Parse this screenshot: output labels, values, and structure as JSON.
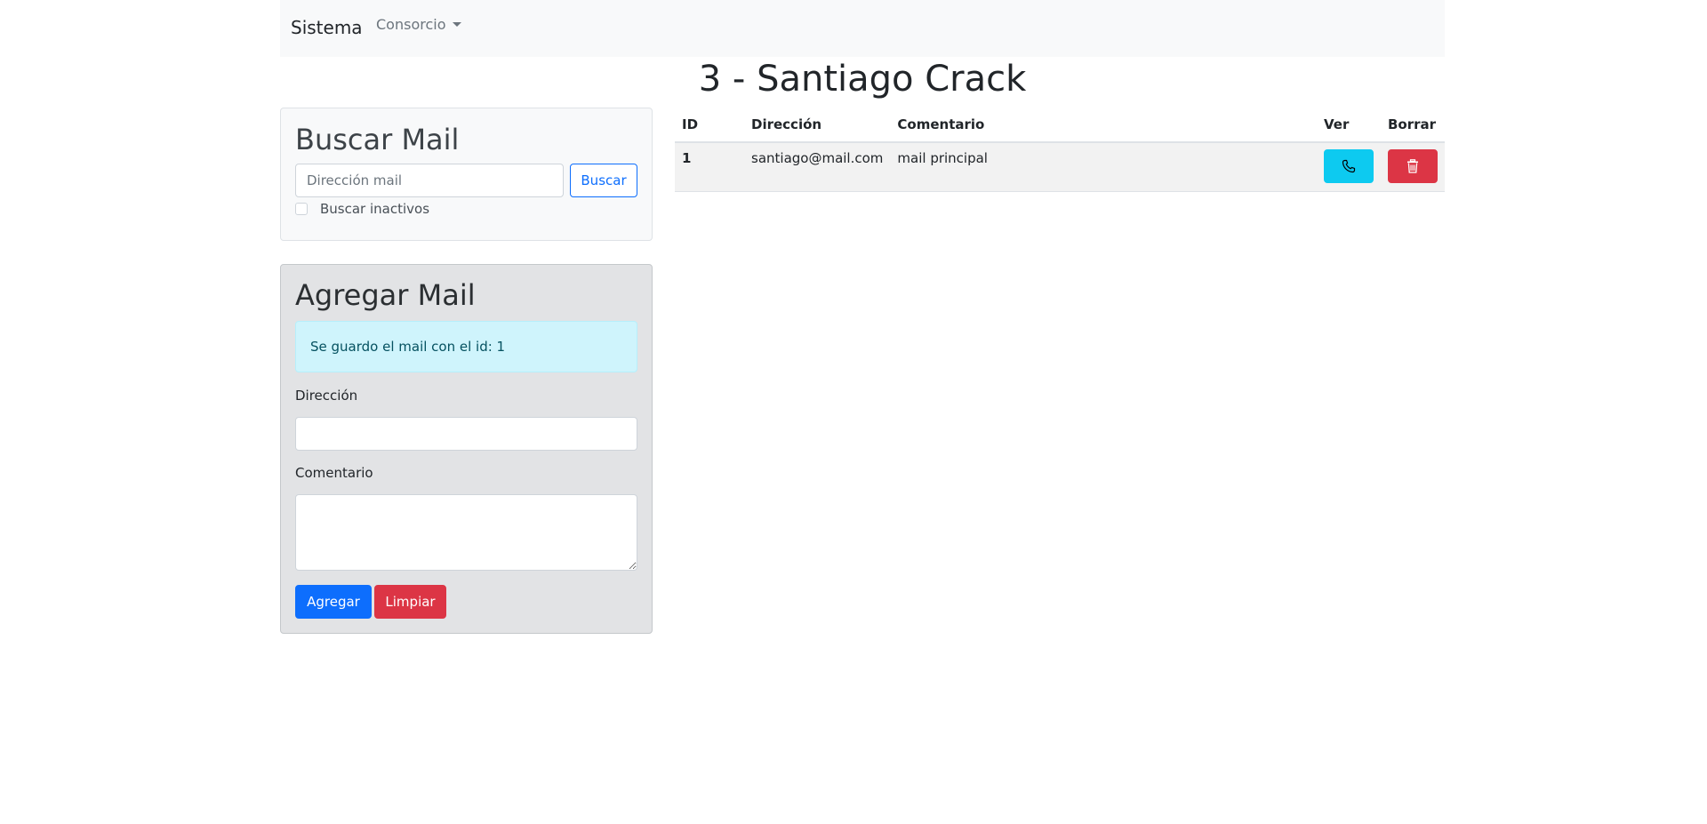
{
  "navbar": {
    "brand": "Sistema",
    "dropdown": "Consorcio"
  },
  "page_title": "3 - Santiago Crack",
  "search_card": {
    "title": "Buscar Mail",
    "input_placeholder": "Dirección mail",
    "search_button": "Buscar",
    "checkbox_label": "Buscar inactivos"
  },
  "add_card": {
    "title": "Agregar Mail",
    "alert": "Se guardo el mail con el id: 1",
    "direccion_label": "Dirección",
    "comentario_label": "Comentario",
    "add_button": "Agregar",
    "clear_button": "Limpiar"
  },
  "table": {
    "headers": [
      "ID",
      "Dirección",
      "Comentario",
      "Ver",
      "Borrar"
    ],
    "rows": [
      {
        "id": "1",
        "direccion": "santiago@mail.com",
        "comentario": "mail principal",
        "ver_icon": "phone-icon",
        "borrar_icon": "trash-icon"
      }
    ]
  },
  "colors": {
    "primary": "#0d6efd",
    "danger": "#dc3545",
    "info": "#0dcaf0",
    "alert_bg": "#cff4fc"
  }
}
